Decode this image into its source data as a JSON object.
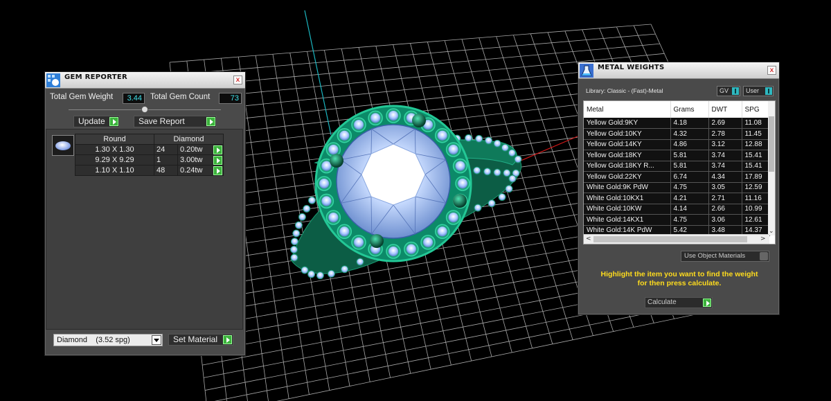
{
  "gem_reporter": {
    "title": "GEM REPORTER",
    "close": "x",
    "total_weight_label": "Total Gem Weight",
    "total_weight_value": "3.44",
    "total_count_label": "Total Gem Count",
    "total_count_value": "73",
    "update_label": "Update",
    "save_report_label": "Save Report",
    "table": {
      "shape_header": "Round",
      "material_header": "Diamond",
      "rows": [
        {
          "size": "1.30 X 1.30",
          "count": "24",
          "weight": "0.20tw"
        },
        {
          "size": "9.29 X 9.29",
          "count": "1",
          "weight": "3.00tw"
        },
        {
          "size": "1.10 X 1.10",
          "count": "48",
          "weight": "0.24tw"
        }
      ]
    },
    "material_select": "Diamond    (3.52 spg)",
    "set_material_label": "Set Material"
  },
  "metal_weights": {
    "title": "METAL WEIGHTS",
    "close": "x",
    "library_label": "Library: Classic - (Fast)-Metal",
    "toggle_gv": "GV",
    "toggle_user": "User",
    "columns": [
      "Metal",
      "Grams",
      "DWT",
      "SPG"
    ],
    "rows": [
      [
        "Yellow Gold:9KY",
        "4.18",
        "2.69",
        "11.08"
      ],
      [
        "Yellow Gold:10KY",
        "4.32",
        "2.78",
        "11.45"
      ],
      [
        "Yellow Gold:14KY",
        "4.86",
        "3.12",
        "12.88"
      ],
      [
        "Yellow Gold:18KY",
        "5.81",
        "3.74",
        "15.41"
      ],
      [
        "Yellow Gold:18KY R...",
        "5.81",
        "3.74",
        "15.41"
      ],
      [
        "Yellow Gold:22KY",
        "6.74",
        "4.34",
        "17.89"
      ],
      [
        "White Gold:9K PdW",
        "4.75",
        "3.05",
        "12.59"
      ],
      [
        "White Gold:10KX1",
        "4.21",
        "2.71",
        "11.16"
      ],
      [
        "White Gold:10KW",
        "4.14",
        "2.66",
        "10.99"
      ],
      [
        "White Gold:14KX1",
        "4.75",
        "3.06",
        "12.61"
      ],
      [
        "White Gold:14K PdW",
        "5.42",
        "3.48",
        "14.37"
      ]
    ],
    "use_object_materials": "Use Object Materials",
    "hint_line1": "Highlight the item you want to find the weight",
    "hint_line2": "for then press calculate.",
    "calculate_label": "Calculate"
  },
  "colors": {
    "grid": "#a9a9a9",
    "metal": "#0e8a66",
    "gem": "#8fb6ff",
    "hint": "#ffdc1e",
    "value_text": "#40e0e8"
  }
}
